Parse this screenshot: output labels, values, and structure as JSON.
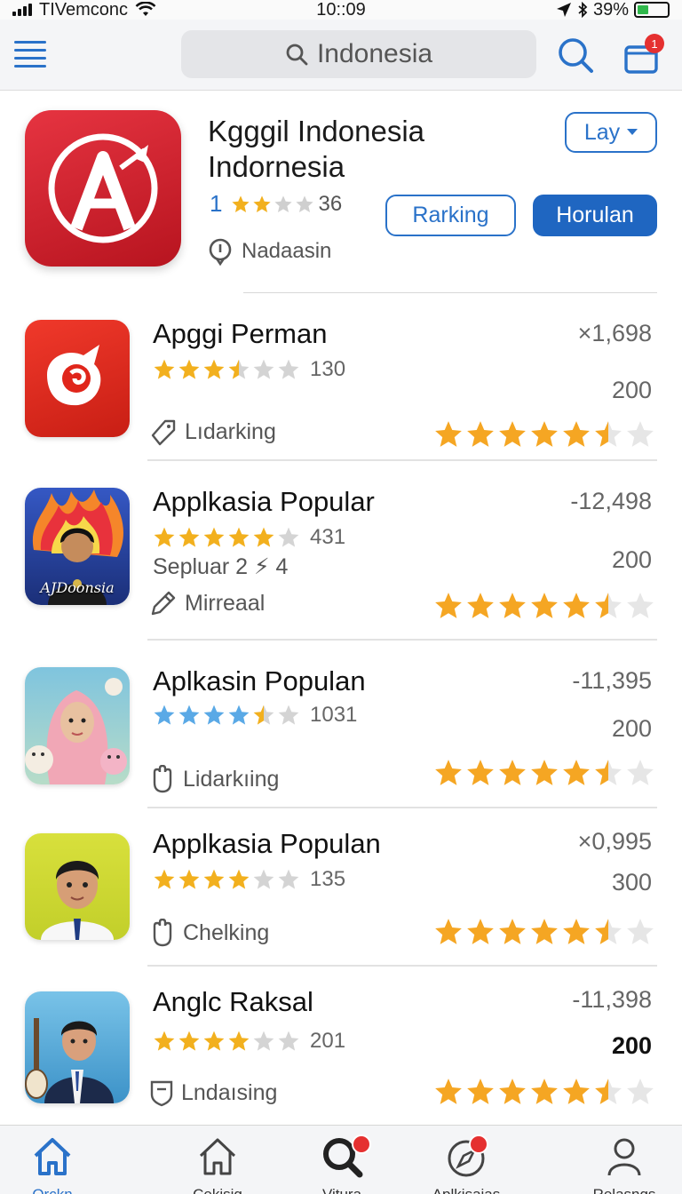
{
  "status_bar": {
    "carrier": "TIVemconc",
    "time": "10::09",
    "battery": "39%",
    "battery_level": 0.39
  },
  "header": {
    "menu_icon": "hamburger-icon",
    "search_text": "Indonesia",
    "search_icon": "search-icon",
    "cart_icon": "cart-icon",
    "cart_badge": "1"
  },
  "featured": {
    "icon": "compass-arrow-logo",
    "title_line1": "Kgggil Indonesia",
    "title_line2": "Indornesia",
    "rating_number": "1",
    "rating_count": "36",
    "rating_stars": 2,
    "location": "Nadaasin",
    "dropdown_label": "Lay",
    "ranking_button": "Rarking",
    "primary_button": "Horulan",
    "accent_color": "#1f66c1",
    "icon_color": "#d4232f"
  },
  "apps": [
    {
      "name": "Apggi Perman",
      "rating_stars": 3.5,
      "rating_count": "130",
      "subtitle": "",
      "tag": "Lıdarking",
      "tag_icon": "tag-icon",
      "downloads": "×1,698",
      "size": "200",
      "size_bold": false,
      "big_stars": 5.5,
      "icon": "red-swirl-logo"
    },
    {
      "name": "Applkasia Popular",
      "rating_stars": 5,
      "rating_count": "431",
      "subtitle": "Sepluar 2 ⚡ 4",
      "tag": "Mirreaal",
      "tag_icon": "pencil-icon",
      "downloads": "-12,498",
      "size": "200",
      "size_bold": false,
      "big_stars": 5.5,
      "icon": "flame-portrait",
      "icon_caption": "AJDoonsia"
    },
    {
      "name": "Aplkasin Populan",
      "rating_stars": 4.5,
      "rating_count": "1031",
      "subtitle": "",
      "tag": "Lidarkıing",
      "tag_icon": "hand-icon",
      "downloads": "-11,395",
      "size": "200",
      "size_bold": false,
      "big_stars": 5.5,
      "icon": "hijab-girl-portrait"
    },
    {
      "name": "Applkasia Populan",
      "rating_stars": 4,
      "rating_count": "135",
      "subtitle": "",
      "tag": "Chelking",
      "tag_icon": "hand-icon",
      "downloads": "×0,995",
      "size": "300",
      "size_bold": false,
      "big_stars": 5.5,
      "icon": "boy-portrait"
    },
    {
      "name": "Anglc Raksal",
      "rating_stars": 4,
      "rating_count": "201",
      "subtitle": "",
      "tag": "Lndaısing",
      "tag_icon": "shield-icon",
      "downloads": "-11,398",
      "size": "200",
      "size_bold": true,
      "big_stars": 5.5,
      "icon": "suit-boy-guitar-portrait"
    }
  ],
  "bottom_nav": [
    {
      "label": "Orckn",
      "icon": "home-icon",
      "active": true
    },
    {
      "label": "Cekisig",
      "icon": "home-outline-icon",
      "active": false
    },
    {
      "label": "Vitura",
      "icon": "search-icon",
      "active": false,
      "badge": true
    },
    {
      "label": "Aplkisaias",
      "icon": "compass-icon",
      "active": false,
      "badge": true
    },
    {
      "label": "Relasngs",
      "icon": "person-icon",
      "active": false
    }
  ]
}
